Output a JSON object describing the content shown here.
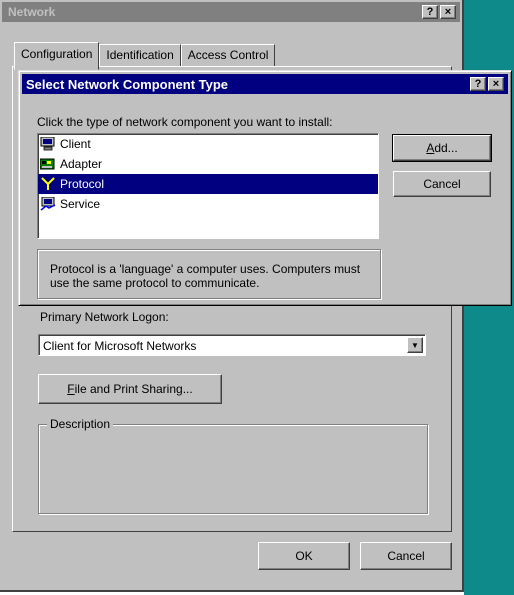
{
  "network_window": {
    "title": "Network",
    "titlebar_buttons": [
      "?",
      "×"
    ],
    "tabs": [
      {
        "label": "Configuration",
        "active": true
      },
      {
        "label": "Identification",
        "active": false
      },
      {
        "label": "Access Control",
        "active": false
      }
    ],
    "primary_logon_label": "Primary Network Logon:",
    "primary_logon_value": "Client for Microsoft Networks",
    "file_print_button": {
      "underlined": "F",
      "rest": "ile and Print Sharing..."
    },
    "description_legend": "Description",
    "ok_button": "OK",
    "cancel_button": "Cancel"
  },
  "select_dialog": {
    "title": "Select Network Component Type",
    "titlebar_buttons": [
      "?",
      "×"
    ],
    "prompt": "Click the type of network component you want to install:",
    "items": [
      {
        "label": "Client",
        "icon": "computer-icon",
        "selected": false
      },
      {
        "label": "Adapter",
        "icon": "network-card-icon",
        "selected": false
      },
      {
        "label": "Protocol",
        "icon": "protocol-icon",
        "selected": true
      },
      {
        "label": "Service",
        "icon": "service-icon",
        "selected": false
      }
    ],
    "add_button": {
      "underlined": "A",
      "rest": "dd..."
    },
    "cancel_button": "Cancel",
    "description": "Protocol is a 'language' a computer uses. Computers must use the same protocol to communicate."
  },
  "colors": {
    "face": "#c0c0c0",
    "active_title": "#000080",
    "inactive_title": "#808080",
    "desktop": "#0f8a8a"
  }
}
